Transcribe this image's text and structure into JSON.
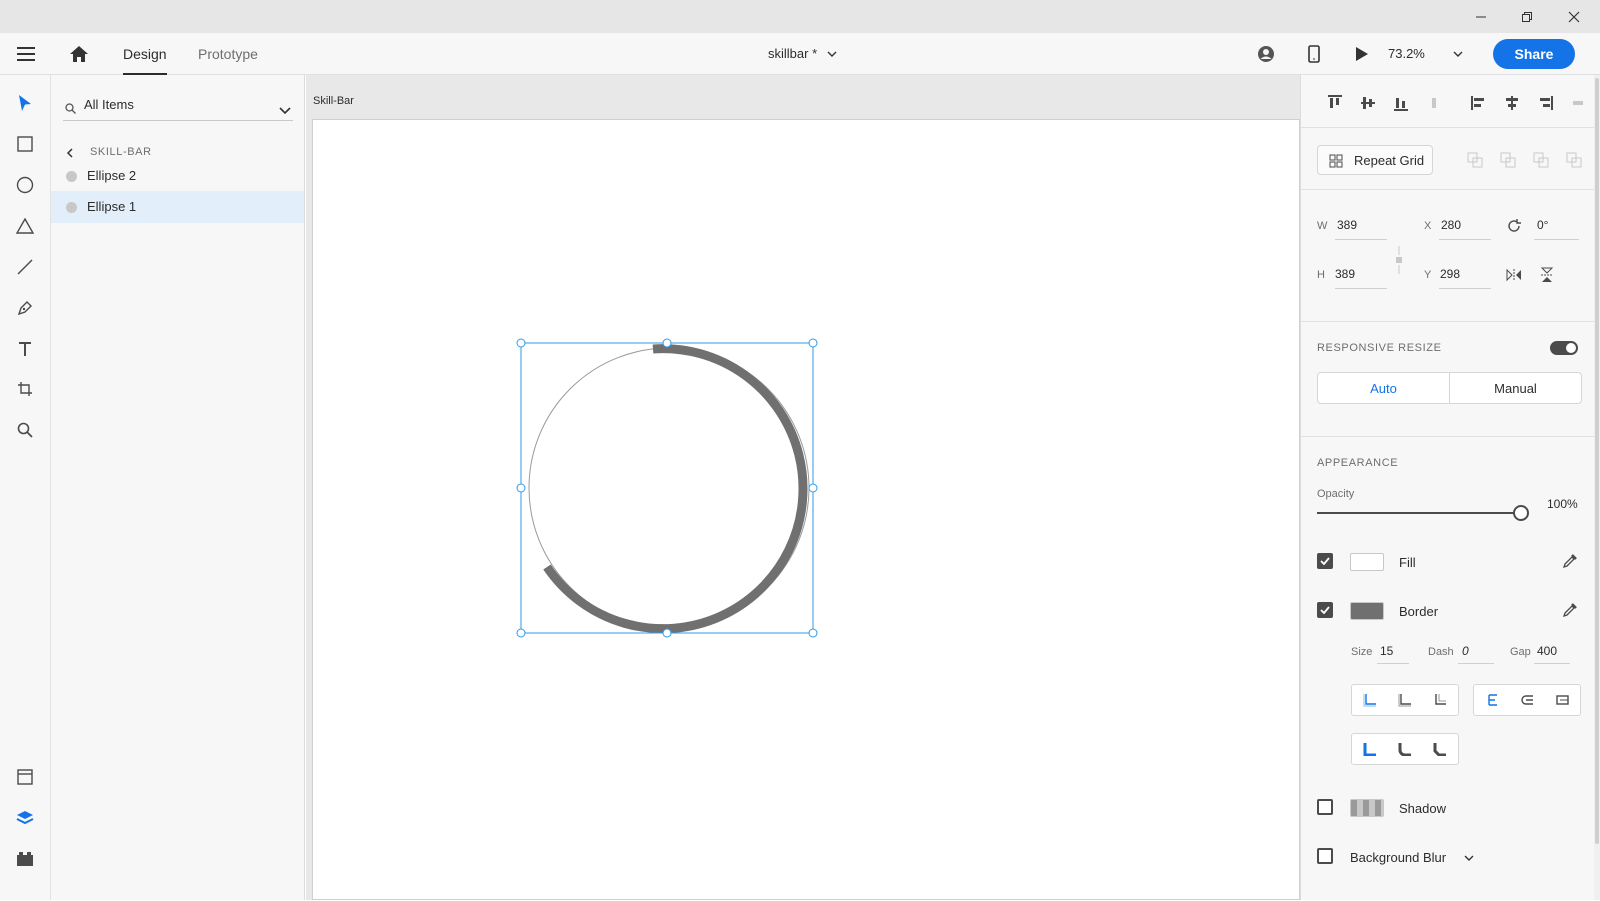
{
  "window": {
    "controls": [
      "minimize-icon",
      "restore-icon",
      "close-icon"
    ]
  },
  "appbar": {
    "tabs": [
      {
        "label": "Design",
        "active": true
      },
      {
        "label": "Prototype",
        "active": false
      }
    ],
    "doc_title": "skillbar *",
    "zoom": "73.2%",
    "share_label": "Share",
    "accent_color": "#1473e6"
  },
  "toolbar": {
    "tools": [
      "select-icon",
      "rectangle-icon",
      "ellipse-icon",
      "polygon-icon",
      "line-icon",
      "pen-icon",
      "text-icon",
      "artboard-icon",
      "zoom-icon"
    ],
    "bottom": [
      "assets-icon",
      "layers-icon",
      "plugins-icon"
    ]
  },
  "layers": {
    "search_placeholder": "All Items",
    "breadcrumb": "SKILL-BAR",
    "items": [
      {
        "name": "Ellipse 2",
        "selected": false
      },
      {
        "name": "Ellipse 1",
        "selected": true
      }
    ]
  },
  "canvas": {
    "artboard_name": "Skill-Bar",
    "selection_color": "#2f9be6",
    "ring_color": "#707070"
  },
  "props": {
    "repeat_grid_label": "Repeat Grid",
    "w_label": "W",
    "w": "389",
    "h_label": "H",
    "h": "389",
    "x_label": "X",
    "x": "280",
    "y_label": "Y",
    "y": "298",
    "rotation": "0°",
    "responsive_title": "RESPONSIVE RESIZE",
    "responsive_on": true,
    "resize_auto": "Auto",
    "resize_manual": "Manual",
    "appearance_title": "APPEARANCE",
    "opacity_label": "Opacity",
    "opacity_value": "100%",
    "opacity": 1.0,
    "fill_label": "Fill",
    "fill_checked": true,
    "fill_color": "#ffffff",
    "border_label": "Border",
    "border_checked": true,
    "border_color": "#707070",
    "size_label": "Size",
    "size": "15",
    "dash_label": "Dash",
    "dash": "0",
    "gap_label": "Gap",
    "gap": "400",
    "shadow_label": "Shadow",
    "shadow_checked": false,
    "blur_label": "Background Blur",
    "blur_checked": false
  }
}
